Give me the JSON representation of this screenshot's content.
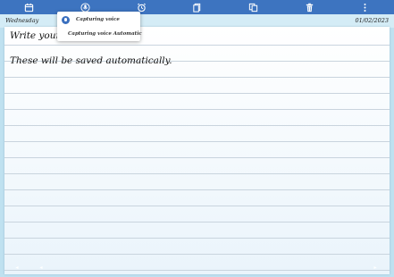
{
  "toolbar": {
    "icons": [
      "calendar-icon",
      "microphone-icon",
      "alarm-clock-icon",
      "copy-icon",
      "duplicate-icon",
      "trash-icon",
      "more-vertical-icon"
    ],
    "color": "#3d74c0"
  },
  "header": {
    "day": "Wednesday",
    "date": "01/02/2023"
  },
  "note": {
    "line1": "Write your N",
    "line2": "These will be saved automatically."
  },
  "voice_menu": {
    "items": [
      {
        "label": "Capturing voice",
        "icon": "voice-capture-icon"
      },
      {
        "label": "Capturing voice Automatic",
        "icon": "voice-capture-auto-icon"
      }
    ]
  },
  "footer": {
    "icons": [
      "scroll-left-icon",
      "scroll-left-icon-2",
      "scroll-right-icon"
    ]
  }
}
